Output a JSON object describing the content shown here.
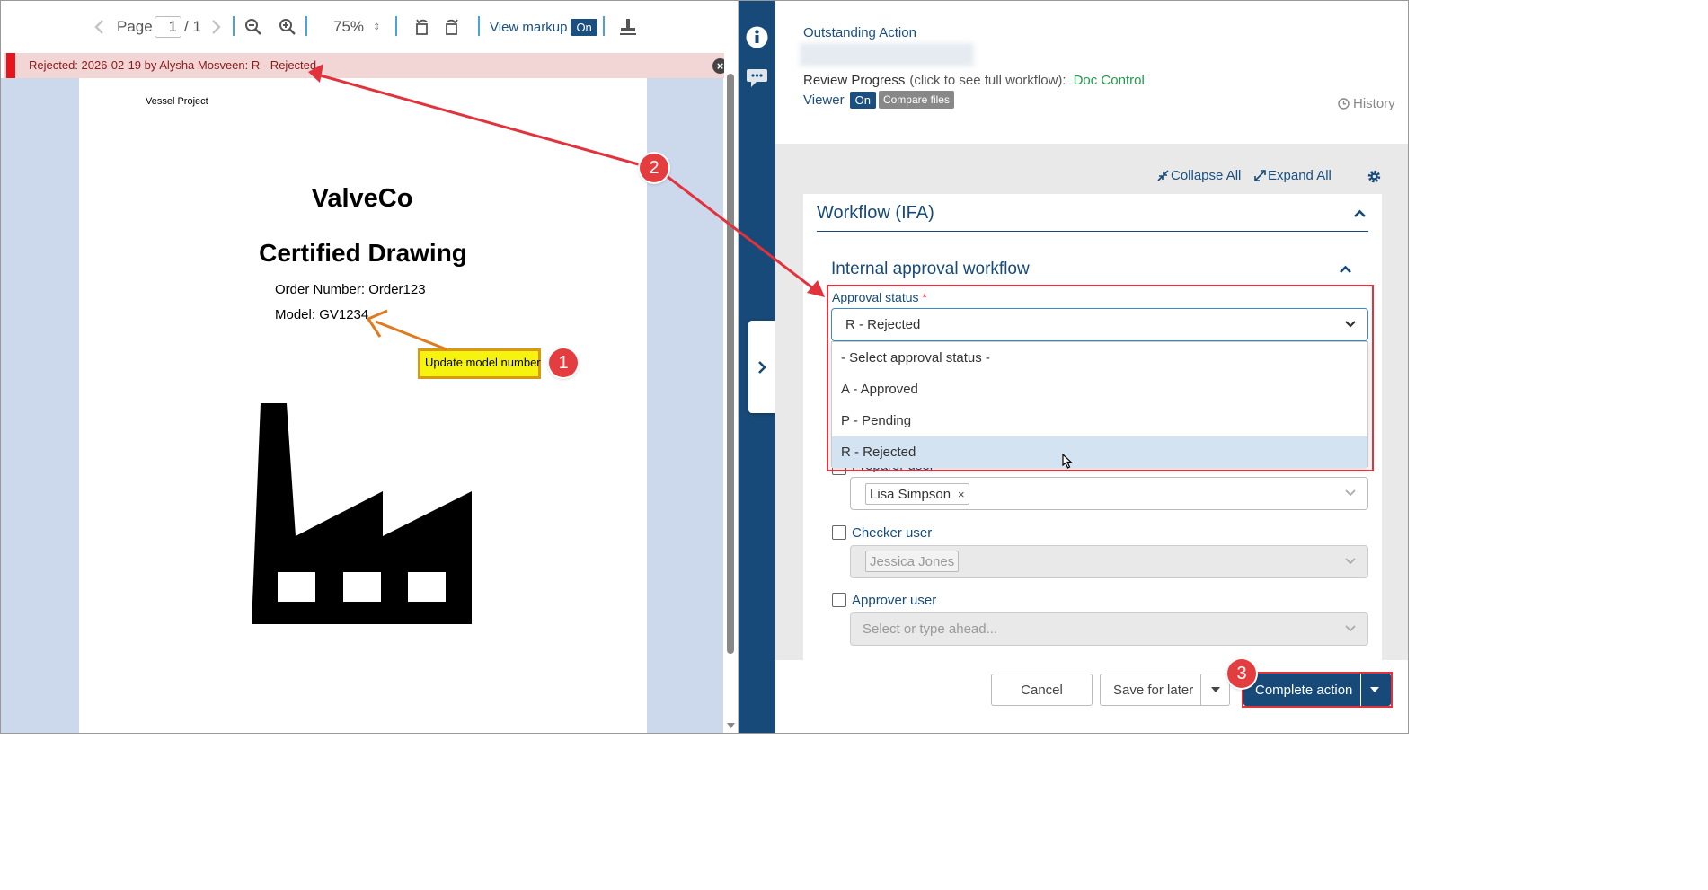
{
  "toolbar": {
    "page_label": "Page",
    "page_value": "1",
    "page_total": "/ 1",
    "zoom": "75%",
    "view_markup": "View markup",
    "view_markup_state": "On"
  },
  "rejection_bar": {
    "text": "Rejected: 2026-02-19 by Alysha Mosveen: R - Rejected"
  },
  "document": {
    "project": "Vessel Project",
    "company": "ValveCo",
    "title": "Certified Drawing",
    "order": "Order Number: Order123",
    "model": "Model: GV1234",
    "annotation": "Update model number"
  },
  "header": {
    "section_label": "Outstanding Action",
    "review_progress_label": "Review Progress",
    "review_progress_hint": "(click to see full workflow):",
    "review_progress_value": "Doc Control",
    "viewer_label": "Viewer",
    "viewer_state": "On",
    "compare_files": "Compare files",
    "history": "History"
  },
  "controls": {
    "collapse_all": "Collapse All",
    "expand_all": "Expand All"
  },
  "workflow": {
    "title": "Workflow (IFA)",
    "subtitle": "Internal approval workflow",
    "approval_label": "Approval status",
    "required_mark": "*",
    "approval_value": "R - Rejected",
    "options": [
      "- Select approval status -",
      "A - Approved",
      "P - Pending",
      "R - Rejected"
    ],
    "preparer_label": "Preparer user",
    "preparer_value": "Lisa Simpson",
    "checker_label": "Checker user",
    "checker_value": "Jessica Jones",
    "approver_label": "Approver user",
    "approver_placeholder": "Select or type ahead..."
  },
  "footer": {
    "cancel": "Cancel",
    "save_for_later": "Save for later",
    "complete_action": "Complete action"
  },
  "callouts": [
    "1",
    "2",
    "3"
  ],
  "colors": {
    "primary": "#174a78",
    "accent_red": "#e43d40",
    "link_green": "#1f9a4a",
    "highlight": "#d3e3f1"
  }
}
